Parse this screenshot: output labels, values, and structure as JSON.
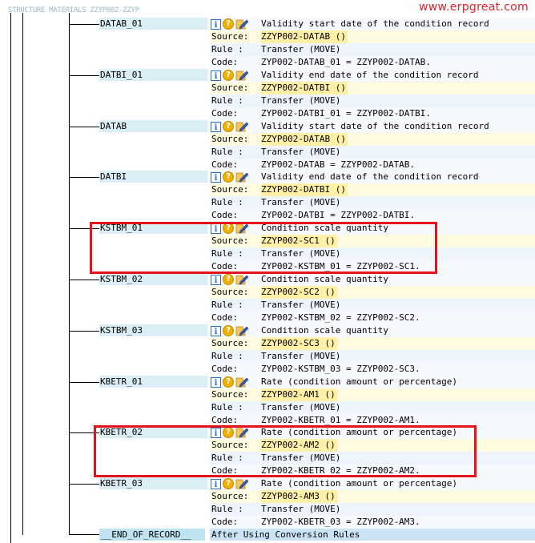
{
  "header_text": "STRUCTURE  MATERIALS  ZZYP002-ZZYP",
  "watermark": "www.erpgreat.com",
  "row_keys": {
    "source": "Source:",
    "rule": "Rule :",
    "code": "Code:"
  },
  "fields": [
    {
      "name": "DATAB_01",
      "desc": "Validity start date of the condition record",
      "source": "ZZYP002-DATAB ()",
      "rule": "Transfer (MOVE)",
      "code": "ZYP002-DATAB_01 = ZZYP002-DATAB."
    },
    {
      "name": "DATBI_01",
      "desc": "Validity end date of the condition record",
      "source": "ZZYP002-DATBI ()",
      "rule": "Transfer (MOVE)",
      "code": "ZYP002-DATBI_01 = ZZYP002-DATBI."
    },
    {
      "name": "DATAB",
      "desc": "Validity start date of the condition record",
      "source": "ZZYP002-DATAB ()",
      "rule": "Transfer (MOVE)",
      "code": "ZYP002-DATAB = ZZYP002-DATAB."
    },
    {
      "name": "DATBI",
      "desc": "Validity end date of the condition record",
      "source": "ZZYP002-DATBI ()",
      "rule": "Transfer (MOVE)",
      "code": "ZYP002-DATBI = ZZYP002-DATBI."
    },
    {
      "name": "KSTBM_01",
      "desc": "Condition scale quantity",
      "source": "ZZYP002-SC1 ()",
      "rule": "Transfer (MOVE)",
      "code": "ZYP002-KSTBM_01 = ZZYP002-SC1."
    },
    {
      "name": "KSTBM_02",
      "desc": "Condition scale quantity",
      "source": "ZZYP002-SC2 ()",
      "rule": "Transfer (MOVE)",
      "code": "ZYP002-KSTBM_02 = ZZYP002-SC2."
    },
    {
      "name": "KSTBM_03",
      "desc": "Condition scale quantity",
      "source": "ZZYP002-SC3 ()",
      "rule": "Transfer (MOVE)",
      "code": "ZYP002-KSTBM_03 = ZZYP002-SC3."
    },
    {
      "name": "KBETR_01",
      "desc": "Rate (condition amount or percentage)",
      "source": "ZZYP002-AM1 ()",
      "rule": "Transfer (MOVE)",
      "code": "ZYP002-KBETR_01 = ZZYP002-AM1."
    },
    {
      "name": "KBETR_02",
      "desc": "Rate (condition amount or percentage)",
      "source": "ZZYP002-AM2 ()",
      "rule": "Transfer (MOVE)",
      "code": "ZYP002-KBETR_02 = ZZYP002-AM2."
    },
    {
      "name": "KBETR_03",
      "desc": "Rate (condition amount or percentage)",
      "source": "ZZYP002-AM3 ()",
      "rule": "Transfer (MOVE)",
      "code": "ZYP002-KBETR_03 = ZZYP002-AM3."
    }
  ],
  "end_record": {
    "name": "__END_OF_RECORD__",
    "desc": "After Using Conversion Rules"
  },
  "icons": [
    "info-icon",
    "help-icon",
    "edit-rule-icon"
  ],
  "highlighted_fields": [
    "KSTBM_01",
    "KBETR_02"
  ],
  "colors": {
    "highlight_box": "#e3121b",
    "label_bg": "#dbeef5",
    "source_bg": "#fff0a8",
    "watermark": "#e0202a"
  }
}
